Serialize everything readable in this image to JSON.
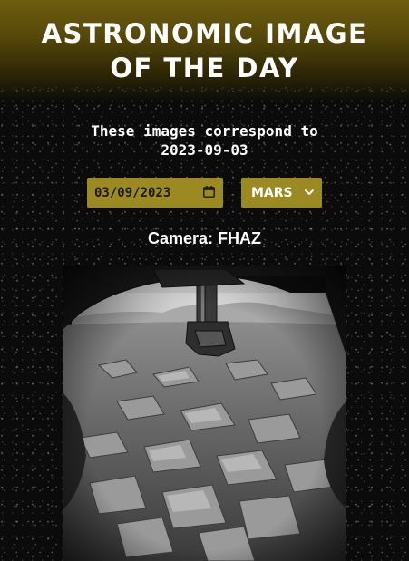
{
  "header": {
    "title": "ASTRONOMIC IMAGE\nOF THE DAY"
  },
  "intro": {
    "line1": "These images correspond to",
    "line2": "2023-09-03"
  },
  "controls": {
    "date_value": "03/09/2023",
    "planet_value": "MARS",
    "accent_color": "#9b8a22"
  },
  "camera": {
    "label": "Camera:",
    "name": "FHAZ"
  },
  "photo": {
    "icon": "rover-hazcam-photo"
  }
}
